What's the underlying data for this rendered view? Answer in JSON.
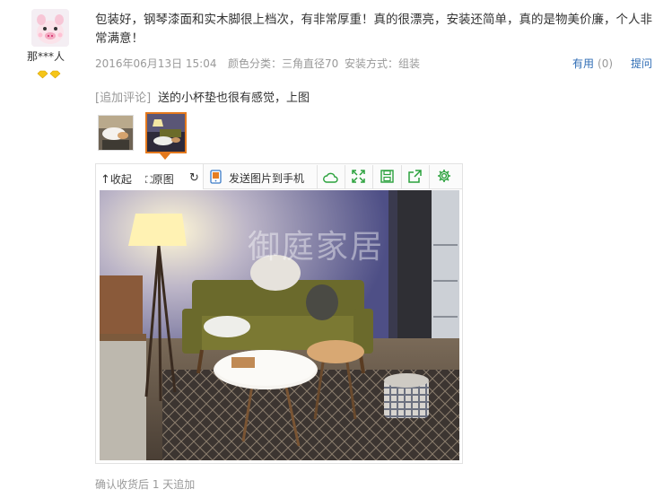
{
  "review": {
    "username": "那***人",
    "text": "包装好，钢琴漆面和实木脚很上档次，有非常厚重！真的很漂亮，安装还简单，真的是物美价廉，个人非常满意！",
    "date": "2016年06月13日 15:04",
    "color_spec": "颜色分类：三角直径70",
    "install_spec": "安装方式：组装",
    "helpful_label": "有用",
    "helpful_count": "(0)",
    "ask_label": "提问"
  },
  "append": {
    "tag": "[追加评论]",
    "text": "送的小杯垫也很有感觉，上图"
  },
  "viewer": {
    "collapse_label": "收起",
    "original_label": "原图",
    "send_label": "发送图片到手机",
    "watermark": "御庭家居"
  },
  "footer": {
    "note": "确认收货后 1 天追加"
  },
  "colors": {
    "link": "#2f6db5",
    "muted": "#999999",
    "selected_thumb_border": "#e4791d",
    "tool_green": "#2aa13c"
  },
  "icons": [
    "avatar-pig",
    "vip-diamond-icon",
    "collapse-arrow-icon",
    "expand-icon",
    "rotate-icon",
    "phone-image-icon",
    "cloud-icon",
    "fullscreen-icon",
    "save-icon",
    "share-icon",
    "settings-icon"
  ]
}
